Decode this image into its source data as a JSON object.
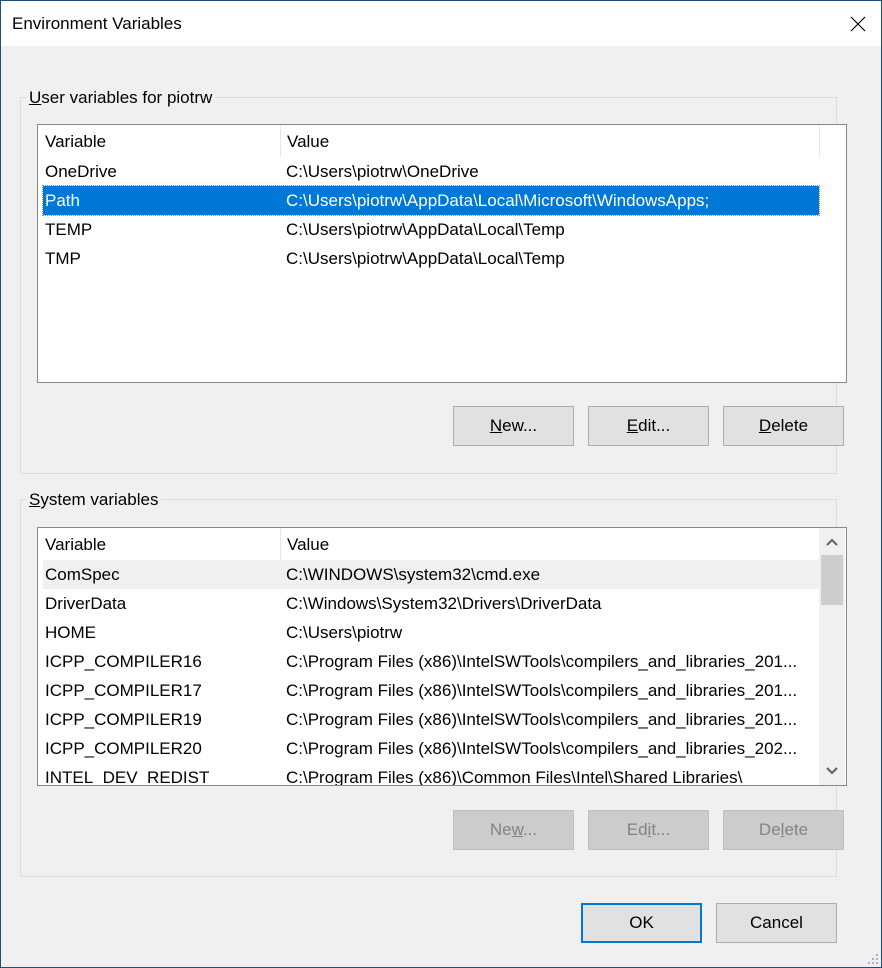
{
  "window": {
    "title": "Environment Variables",
    "close_icon": "close-icon"
  },
  "user_vars": {
    "group_label_mnemonic": "U",
    "group_label_rest": "ser variables for piotrw",
    "columns": [
      "Variable",
      "Value"
    ],
    "rows": [
      {
        "variable": "OneDrive",
        "value": "C:\\Users\\piotrw\\OneDrive",
        "selected": false
      },
      {
        "variable": "Path",
        "value": "C:\\Users\\piotrw\\AppData\\Local\\Microsoft\\WindowsApps;",
        "selected": true
      },
      {
        "variable": "TEMP",
        "value": "C:\\Users\\piotrw\\AppData\\Local\\Temp",
        "selected": false
      },
      {
        "variable": "TMP",
        "value": "C:\\Users\\piotrw\\AppData\\Local\\Temp",
        "selected": false
      }
    ],
    "buttons": {
      "new": {
        "mn": "N",
        "rest": "ew..."
      },
      "edit": {
        "mn": "E",
        "rest": "dit..."
      },
      "delete": {
        "mn": "D",
        "rest": "elete"
      }
    }
  },
  "system_vars": {
    "group_label_mnemonic": "S",
    "group_label_rest": "ystem variables",
    "columns": [
      "Variable",
      "Value"
    ],
    "rows": [
      {
        "variable": "ComSpec",
        "value": "C:\\WINDOWS\\system32\\cmd.exe",
        "hover": true
      },
      {
        "variable": "DriverData",
        "value": "C:\\Windows\\System32\\Drivers\\DriverData"
      },
      {
        "variable": "HOME",
        "value": "C:\\Users\\piotrw"
      },
      {
        "variable": "ICPP_COMPILER16",
        "value": "C:\\Program Files (x86)\\IntelSWTools\\compilers_and_libraries_201..."
      },
      {
        "variable": "ICPP_COMPILER17",
        "value": "C:\\Program Files (x86)\\IntelSWTools\\compilers_and_libraries_201..."
      },
      {
        "variable": "ICPP_COMPILER19",
        "value": "C:\\Program Files (x86)\\IntelSWTools\\compilers_and_libraries_201..."
      },
      {
        "variable": "ICPP_COMPILER20",
        "value": "C:\\Program Files (x86)\\IntelSWTools\\compilers_and_libraries_202..."
      },
      {
        "variable": "INTEL_DEV_REDIST",
        "value": "C:\\Program Files (x86)\\Common Files\\Intel\\Shared Libraries\\"
      }
    ],
    "buttons": {
      "new": {
        "pre": "Ne",
        "mn": "w",
        "rest": "..."
      },
      "edit": {
        "pre": "Ed",
        "mn": "i",
        "rest": "t..."
      },
      "delete": {
        "pre": "De",
        "mn": "l",
        "rest": "ete"
      }
    },
    "buttons_disabled": true
  },
  "footer": {
    "ok": "OK",
    "cancel": "Cancel"
  },
  "colors": {
    "selection": "#0078d7",
    "window_border": "#1f4e79",
    "background": "#f0f0f0"
  }
}
